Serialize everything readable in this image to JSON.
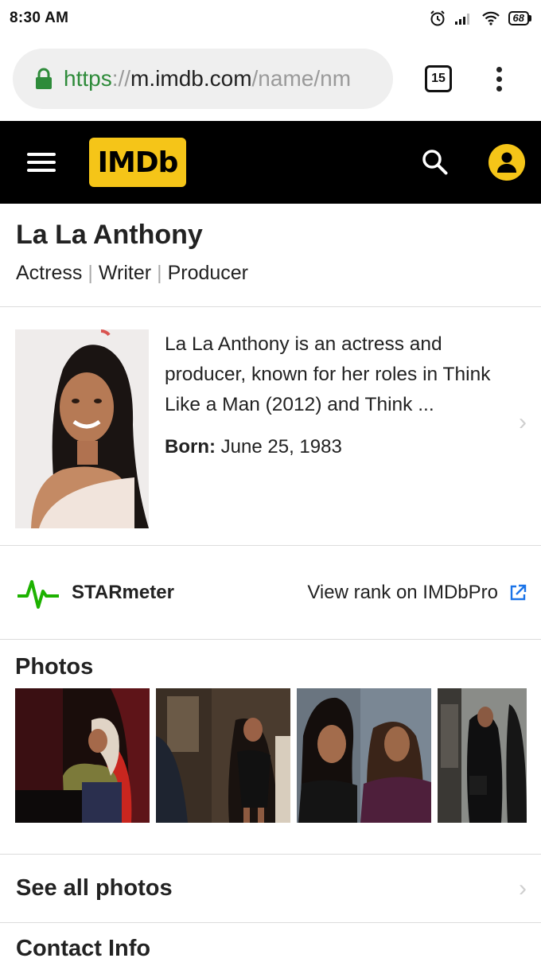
{
  "status_bar": {
    "time": "8:30 AM",
    "battery": "68"
  },
  "browser": {
    "url_scheme": "https",
    "url_sep": "://",
    "url_host": "m.imdb.com",
    "url_path": "/name/nm",
    "tab_count": "15"
  },
  "header": {
    "logo": "IMDb"
  },
  "person": {
    "name": "La La Anthony",
    "roles": [
      "Actress",
      "Writer",
      "Producer"
    ],
    "role_separator": "|",
    "bio": "La La Anthony is an actress and producer, known for her roles in Think Like a Man (2012) and Think ...",
    "born_label": "Born:",
    "born_value": "June 25, 1983"
  },
  "starmeter": {
    "label": "STARmeter",
    "link": "View rank on IMDbPro"
  },
  "photos": {
    "title": "Photos",
    "see_all": "See all photos",
    "count_visible": 4
  },
  "contact": {
    "title": "Contact Info"
  },
  "colors": {
    "imdb_yellow": "#f5c518",
    "secure_green": "#2e8b3a",
    "link_blue": "#1a73e8",
    "starmeter_green": "#1db200"
  }
}
